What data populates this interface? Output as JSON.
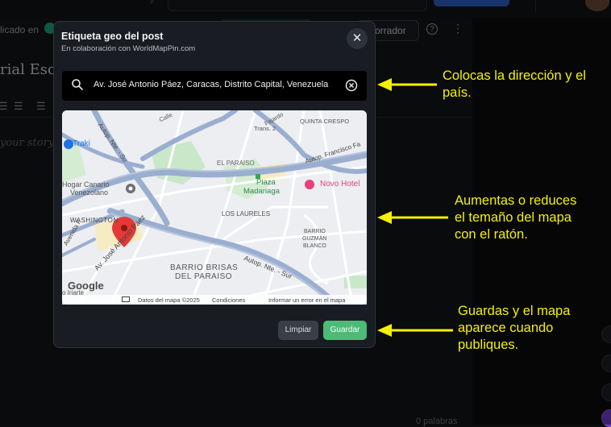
{
  "background": {
    "published_in_label": "licado en",
    "draft_button_label": "orrador",
    "help_symbol": "?",
    "more_symbol": "⋮",
    "title_text": "rial Escri",
    "story_placeholder": "your story...",
    "word_count": "0 palabras"
  },
  "dialog": {
    "title": "Etiqueta geo del post",
    "subtitle": "En colaboración con WorldMapPin.com",
    "close_symbol": "✕",
    "search": {
      "value": "Av. José Antonio Páez, Caracas, Distrito Capital, Venezuela",
      "placeholder": ""
    },
    "map": {
      "labels": {
        "traki": "Traki",
        "hogar1": "Hogar Canario",
        "hogar2": "Venezolano",
        "washington": "WASHINGTON",
        "avenida_f": "Avenida F",
        "av_jose": "Av. José Antonio Páez",
        "barrio1": "BARRIO BRISAS",
        "barrio2": "DEL PARAISO",
        "el_paraiso": "EL PARAISO",
        "plaza1": "Plaza",
        "plaza2": "Madariaga",
        "novo_hotel": "Novo Hotel",
        "los_laureles": "LOS LAURELES",
        "barrio_guzman1": "BARRIO",
        "barrio_guzman2": "GUZMÁN",
        "barrio_guzman3": "BLANCO",
        "quinta_crespo": "QUINTA CRESPO",
        "trans2": "Trans. 2",
        "calle": "Calle",
        "autop_fajardo": "Autop. Francisco Fa",
        "autop_nte_top": "Autop. Nte. - Su",
        "autop_nte_bottom": "Autop. Nte. - Sur",
        "fajardo": "Fajardo",
        "irlarte": "o Iriarte",
        "google": "Google"
      },
      "footer": {
        "data": "Datos del mapa ©2025",
        "conditions": "Condiciones",
        "report": "Informar un error en el mapa"
      }
    },
    "buttons": {
      "clear": "Limpiar",
      "save": "Guardar"
    }
  },
  "annotations": {
    "note1": [
      "Colocas la dirección y el",
      "país."
    ],
    "note2": [
      "Aumentas o reduces",
      "el temaño del mapa",
      "con el ratón."
    ],
    "note3": [
      "Guardas y el mapa",
      "aparece cuando",
      "publiques."
    ]
  },
  "colors": {
    "accent_green": "#4dbb77",
    "annotation_yellow": "#f5f000",
    "map_pin": "#e53935"
  }
}
